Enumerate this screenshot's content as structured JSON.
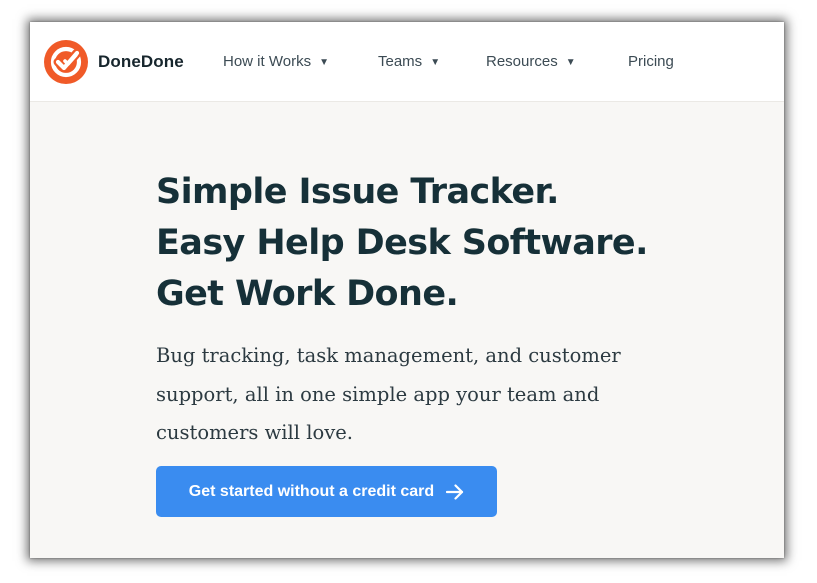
{
  "brand": {
    "name": "DoneDone",
    "logo_color": "#f05a28",
    "logo_icon": "double-check-icon"
  },
  "nav": {
    "items": [
      {
        "label": "How it Works",
        "has_dropdown": true
      },
      {
        "label": "Teams",
        "has_dropdown": true
      },
      {
        "label": "Resources",
        "has_dropdown": true
      },
      {
        "label": "Pricing",
        "has_dropdown": false
      }
    ],
    "caret_glyph": "▼"
  },
  "hero": {
    "headline_lines": [
      "Simple Issue Tracker.",
      "Easy Help Desk Software.",
      "Get Work Done."
    ],
    "subcopy": "Bug tracking, task management, and customer support, all in one simple app your team and customers will love."
  },
  "cta": {
    "label": "Get started without a credit card",
    "icon": "arrow-right-icon",
    "color": "#3a8cf0"
  },
  "colors": {
    "heading": "#163038",
    "body_text": "#2c3a41",
    "page_background": "#f8f7f5"
  }
}
